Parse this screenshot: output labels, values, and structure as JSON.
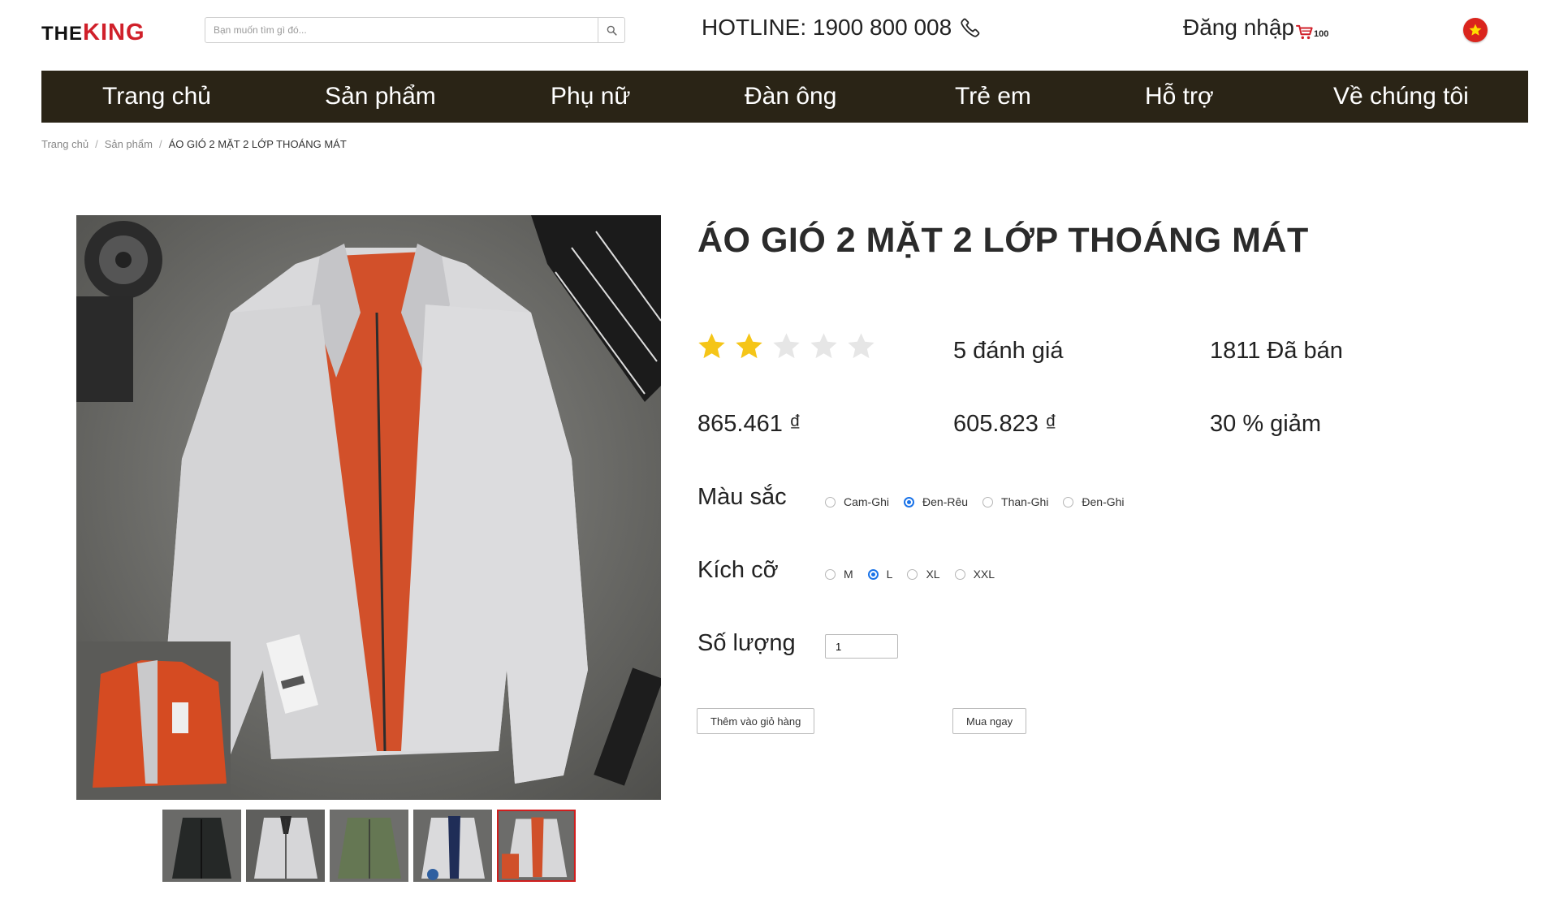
{
  "header": {
    "logo_the": "THE",
    "logo_king": "KING",
    "search_placeholder": "Bạn muốn tìm gì đó...",
    "hotline": "HOTLINE: 1900 800 008",
    "login": "Đăng nhập",
    "cart_count": "100"
  },
  "nav": {
    "items": [
      "Trang chủ",
      "Sản phẩm",
      "Phụ nữ",
      "Đàn ông",
      "Trẻ em",
      "Hỗ trợ",
      "Về chúng tôi"
    ]
  },
  "breadcrumb": {
    "items": [
      "Trang chủ",
      "Sản phẩm",
      "ÁO GIÓ 2 MẶT 2 LỚP THOÁNG MÁT"
    ],
    "separator": "/"
  },
  "product": {
    "title": "ÁO GIÓ 2 MẶT 2 LỚP THOÁNG MÁT",
    "rating": 2,
    "rating_max": 5,
    "reviews": "5 đánh giá",
    "sold": "1811 Đã bán",
    "old_price": "865.461 ₫",
    "new_price": "605.823 ₫",
    "discount": "30 % giảm",
    "color_label": "Màu sắc",
    "colors": [
      "Cam-Ghi",
      "Đen-Rêu",
      "Than-Ghi",
      "Đen-Ghi"
    ],
    "selected_color": "Đen-Rêu",
    "size_label": "Kích cỡ",
    "sizes": [
      "M",
      "L",
      "XL",
      "XXL"
    ],
    "selected_size": "L",
    "quantity_label": "Số lượng",
    "quantity": "1",
    "add_to_cart": "Thêm vào giỏ hàng",
    "buy_now": "Mua ngay",
    "thumbnails": [
      "black-jacket",
      "grey-jacket",
      "olive-jacket",
      "grey-navy-jacket",
      "grey-orange-jacket"
    ],
    "selected_thumbnail": 4
  },
  "colors": {
    "nav_bg": "#2a2416",
    "brand_red": "#d0202a",
    "star_on": "#f5c518",
    "star_off": "#e6e6e6",
    "accent": "#1a73e8"
  }
}
